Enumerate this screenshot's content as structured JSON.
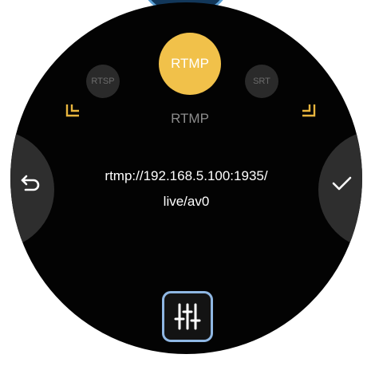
{
  "protocols": {
    "active_label": "RTMP",
    "left_label": "RTSP",
    "right_label": "SRT"
  },
  "mode_title": "RTMP",
  "stream_url": {
    "line1": "rtmp://192.168.5.100:1935/",
    "line2": "live/av0"
  },
  "icons": {
    "back": "undo-arrow-icon",
    "confirm": "check-icon",
    "settings": "sliders-icon",
    "brackets": "corner-bracket-icon"
  },
  "colors": {
    "accent": "#f1c14a",
    "dial_background": "#030303",
    "settings_highlight": "#8fb7e3",
    "top_indicator": "#12375a"
  }
}
